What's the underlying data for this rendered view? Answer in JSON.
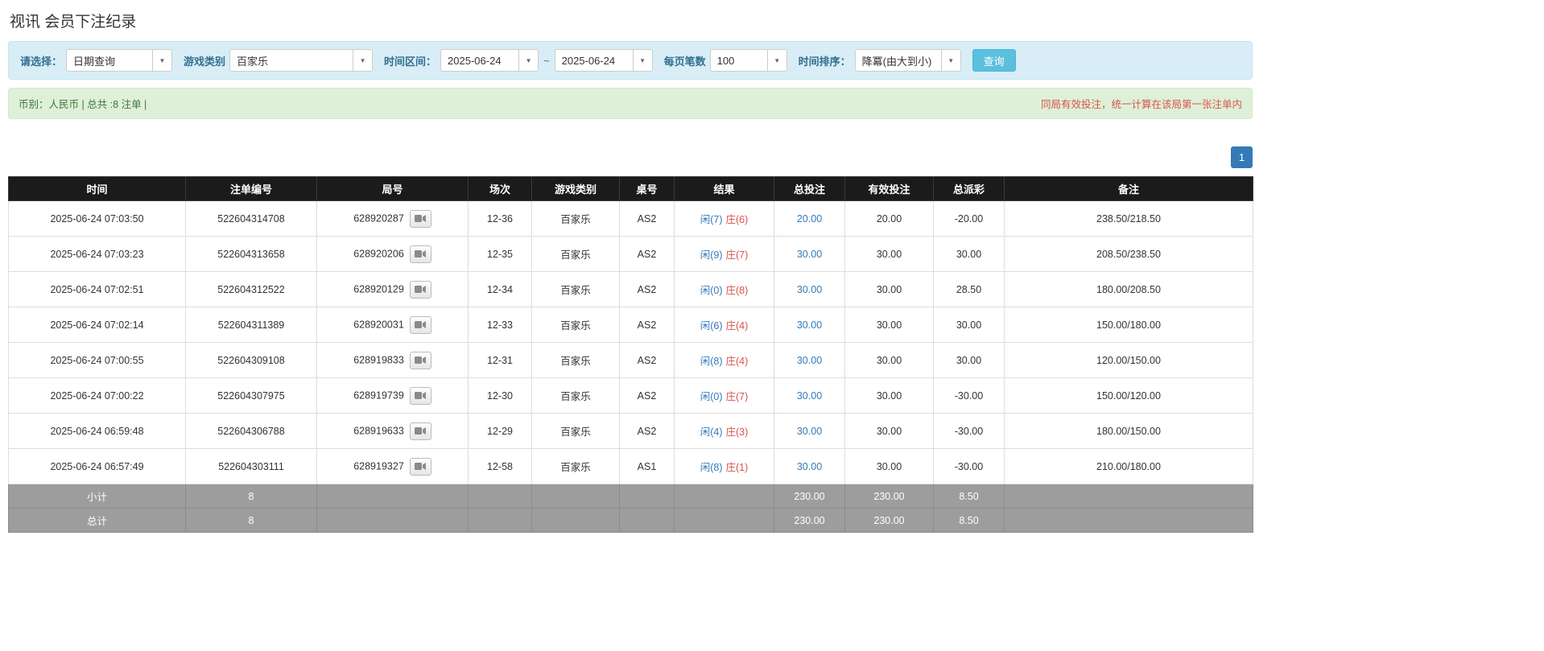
{
  "page": {
    "title": "视讯 会员下注纪录"
  },
  "filters": {
    "query_type": {
      "label": "请选择：",
      "value": "日期查询"
    },
    "game_type": {
      "label": "游戏类别",
      "value": "百家乐"
    },
    "time_range": {
      "label": "时间区间：",
      "from": "2025-06-24",
      "separator": "~",
      "to": "2025-06-24"
    },
    "page_size": {
      "label": "每页笔数",
      "value": "100"
    },
    "sort": {
      "label": "时间排序：",
      "value": "降冪(由大到小)"
    },
    "search_label": "查询"
  },
  "summary": {
    "left": "币别：人民币 | 总共 :8 注单 |",
    "right": "同局有效投注，统一计算在该局第一张注单内"
  },
  "pagination": {
    "current": "1"
  },
  "colors": {
    "accent_blue": "#337ab7",
    "negative_red": "#d9534f",
    "header_bg": "#1b1b1b",
    "footer_bg": "#9d9d9d",
    "filter_bg": "#d9edf7",
    "summary_bg": "#dff0d8",
    "search_button_bg": "#5bc0de"
  },
  "table": {
    "headers": [
      "时间",
      "注单编号",
      "局号",
      "场次",
      "游戏类别",
      "桌号",
      "结果",
      "总投注",
      "有效投注",
      "总派彩",
      "备注"
    ],
    "rows": [
      {
        "time": "2025-06-24 07:03:50",
        "bet_id": "522604314708",
        "round_id": "628920287",
        "session": "12-36",
        "game": "百家乐",
        "table_no": "AS2",
        "result_player": "闲(7)",
        "result_banker": "庄(6)",
        "total_bet": "20.00",
        "valid_bet": "20.00",
        "payout": "-20.00",
        "note": "238.50/218.50"
      },
      {
        "time": "2025-06-24 07:03:23",
        "bet_id": "522604313658",
        "round_id": "628920206",
        "session": "12-35",
        "game": "百家乐",
        "table_no": "AS2",
        "result_player": "闲(9)",
        "result_banker": "庄(7)",
        "total_bet": "30.00",
        "valid_bet": "30.00",
        "payout": "30.00",
        "note": "208.50/238.50"
      },
      {
        "time": "2025-06-24 07:02:51",
        "bet_id": "522604312522",
        "round_id": "628920129",
        "session": "12-34",
        "game": "百家乐",
        "table_no": "AS2",
        "result_player": "闲(0)",
        "result_banker": "庄(8)",
        "total_bet": "30.00",
        "valid_bet": "30.00",
        "payout": "28.50",
        "note": "180.00/208.50"
      },
      {
        "time": "2025-06-24 07:02:14",
        "bet_id": "522604311389",
        "round_id": "628920031",
        "session": "12-33",
        "game": "百家乐",
        "table_no": "AS2",
        "result_player": "闲(6)",
        "result_banker": "庄(4)",
        "total_bet": "30.00",
        "valid_bet": "30.00",
        "payout": "30.00",
        "note": "150.00/180.00"
      },
      {
        "time": "2025-06-24 07:00:55",
        "bet_id": "522604309108",
        "round_id": "628919833",
        "session": "12-31",
        "game": "百家乐",
        "table_no": "AS2",
        "result_player": "闲(8)",
        "result_banker": "庄(4)",
        "total_bet": "30.00",
        "valid_bet": "30.00",
        "payout": "30.00",
        "note": "120.00/150.00"
      },
      {
        "time": "2025-06-24 07:00:22",
        "bet_id": "522604307975",
        "round_id": "628919739",
        "session": "12-30",
        "game": "百家乐",
        "table_no": "AS2",
        "result_player": "闲(0)",
        "result_banker": "庄(7)",
        "total_bet": "30.00",
        "valid_bet": "30.00",
        "payout": "-30.00",
        "note": "150.00/120.00"
      },
      {
        "time": "2025-06-24 06:59:48",
        "bet_id": "522604306788",
        "round_id": "628919633",
        "session": "12-29",
        "game": "百家乐",
        "table_no": "AS2",
        "result_player": "闲(4)",
        "result_banker": "庄(3)",
        "total_bet": "30.00",
        "valid_bet": "30.00",
        "payout": "-30.00",
        "note": "180.00/150.00"
      },
      {
        "time": "2025-06-24 06:57:49",
        "bet_id": "522604303111",
        "round_id": "628919327",
        "session": "12-58",
        "game": "百家乐",
        "table_no": "AS1",
        "result_player": "闲(8)",
        "result_banker": "庄(1)",
        "total_bet": "30.00",
        "valid_bet": "30.00",
        "payout": "-30.00",
        "note": "210.00/180.00"
      }
    ],
    "subtotal": {
      "label": "小计",
      "count": "8",
      "total_bet": "230.00",
      "valid_bet": "230.00",
      "payout": "8.50"
    },
    "total": {
      "label": "总计",
      "count": "8",
      "total_bet": "230.00",
      "valid_bet": "230.00",
      "payout": "8.50"
    }
  }
}
